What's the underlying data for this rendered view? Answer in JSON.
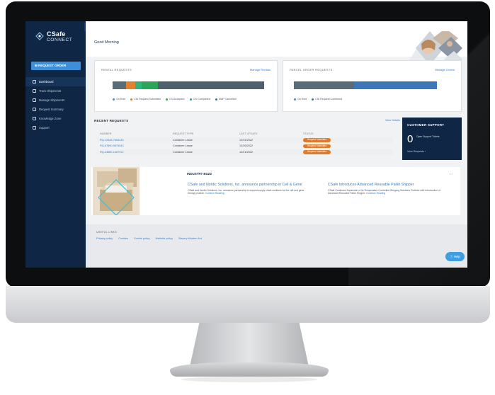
{
  "app": {
    "brand_line1": "CSafe",
    "brand_line2": "CONNECT",
    "collapse_glyph": "‹"
  },
  "sidebar": {
    "request_order": "REQUEST ORDER",
    "items": [
      {
        "label": "Dashboard",
        "icon": "home-icon",
        "active": true
      },
      {
        "label": "Track Shipments",
        "icon": "truck-icon",
        "active": false
      },
      {
        "label": "Manage Shipments",
        "icon": "box-icon",
        "active": false
      },
      {
        "label": "Request Summary",
        "icon": "summary-icon",
        "active": false
      },
      {
        "label": "Knowledge Zone",
        "icon": "book-icon",
        "active": false
      },
      {
        "label": "Support",
        "icon": "support-icon",
        "active": false
      }
    ]
  },
  "header": {
    "greeting": "Good Morning"
  },
  "rental_requests": {
    "title": "RENTAL REQUESTS",
    "link": "Manage Rentals",
    "segments": [
      {
        "fraction": 0.09,
        "color": "#5b6b78"
      },
      {
        "fraction": 0.06,
        "color": "#e0822e"
      },
      {
        "fraction": 0.04,
        "color": "#2fb37a"
      },
      {
        "fraction": 0.11,
        "color": "#2aa55a"
      },
      {
        "fraction": 0.7,
        "color": "#4f5f6c"
      }
    ],
    "legend": [
      {
        "label": "On Hold",
        "color": "#3a8bd3"
      },
      {
        "label": "CSI Request Submitted",
        "color": "#e07b2c"
      },
      {
        "label": "CSI Accepted",
        "color": "#2aa55a"
      },
      {
        "label": "CSI Completed",
        "color": "#23a48f"
      },
      {
        "label": "MAP Cancelled",
        "color": "#3a6fb0"
      }
    ]
  },
  "parcel_orders": {
    "title": "PARCEL ORDER REQUESTS",
    "link": "Manage Orders",
    "segments": [
      {
        "fraction": 0.42,
        "color": "#5b6b78"
      },
      {
        "fraction": 0.58,
        "color": "#3c78b8"
      }
    ],
    "legend": [
      {
        "label": "On Hold",
        "color": "#3a8bd3"
      },
      {
        "label": "CSI Request Confirmed",
        "color": "#3a6fb0"
      }
    ]
  },
  "recent_requests": {
    "title": "RECENT REQUESTS",
    "view_link": "View Details",
    "columns": [
      "NUMBER",
      "REQUEST TYPE",
      "LAST UPDATE",
      "STATUS"
    ],
    "rows": [
      {
        "number": "RQ-12345-7654432",
        "type": "Container Lease",
        "date": "12/31/2022",
        "status": "Request Submitted"
      },
      {
        "number": "RQ-67890-9876543",
        "type": "Container Lease",
        "date": "12/26/2022",
        "status": "Request Submitted"
      },
      {
        "number": "RQ-24680-1357912",
        "type": "Container Lease",
        "date": "12/21/2022",
        "status": "Request Submitted"
      }
    ]
  },
  "customer_support": {
    "title": "CUSTOMER SUPPORT",
    "count": "0",
    "label": "Open Support Tickets",
    "link": "View Requests ›"
  },
  "industry_buzz": {
    "title": "INDUSTRY BUZZ",
    "control": "‹ ›",
    "articles": [
      {
        "title": "CSafe and Nordic Solutions, Inc. announce partnership in Cell & Gene",
        "desc": "CSafe and Nordic Solutions, Inc. announce partnership to expand supply chain solutions for the cell and gene therapy market.",
        "more": "Continue Reading"
      },
      {
        "title": "CSafe Introduces Advanced Reusable Pallet Shipper",
        "desc": "CSafe Continues Expansion of its Temperature-Controlled Shipping Solutions Portfolio with Introduction of Advanced Reusable Pallet Shipper.",
        "more": "Continue Reading"
      }
    ]
  },
  "footer": {
    "heading": "USEFUL LINKS",
    "links": [
      "Privacy policy",
      "Cookies",
      "Cookie policy",
      "Website policy",
      "Slavery Modern Act"
    ]
  },
  "help": {
    "label": "Help"
  },
  "colors": {
    "sidebar": "#0f2745",
    "accent": "#3e8fd8",
    "status_badge": "#e07b2c",
    "link": "#2f7fd0"
  }
}
